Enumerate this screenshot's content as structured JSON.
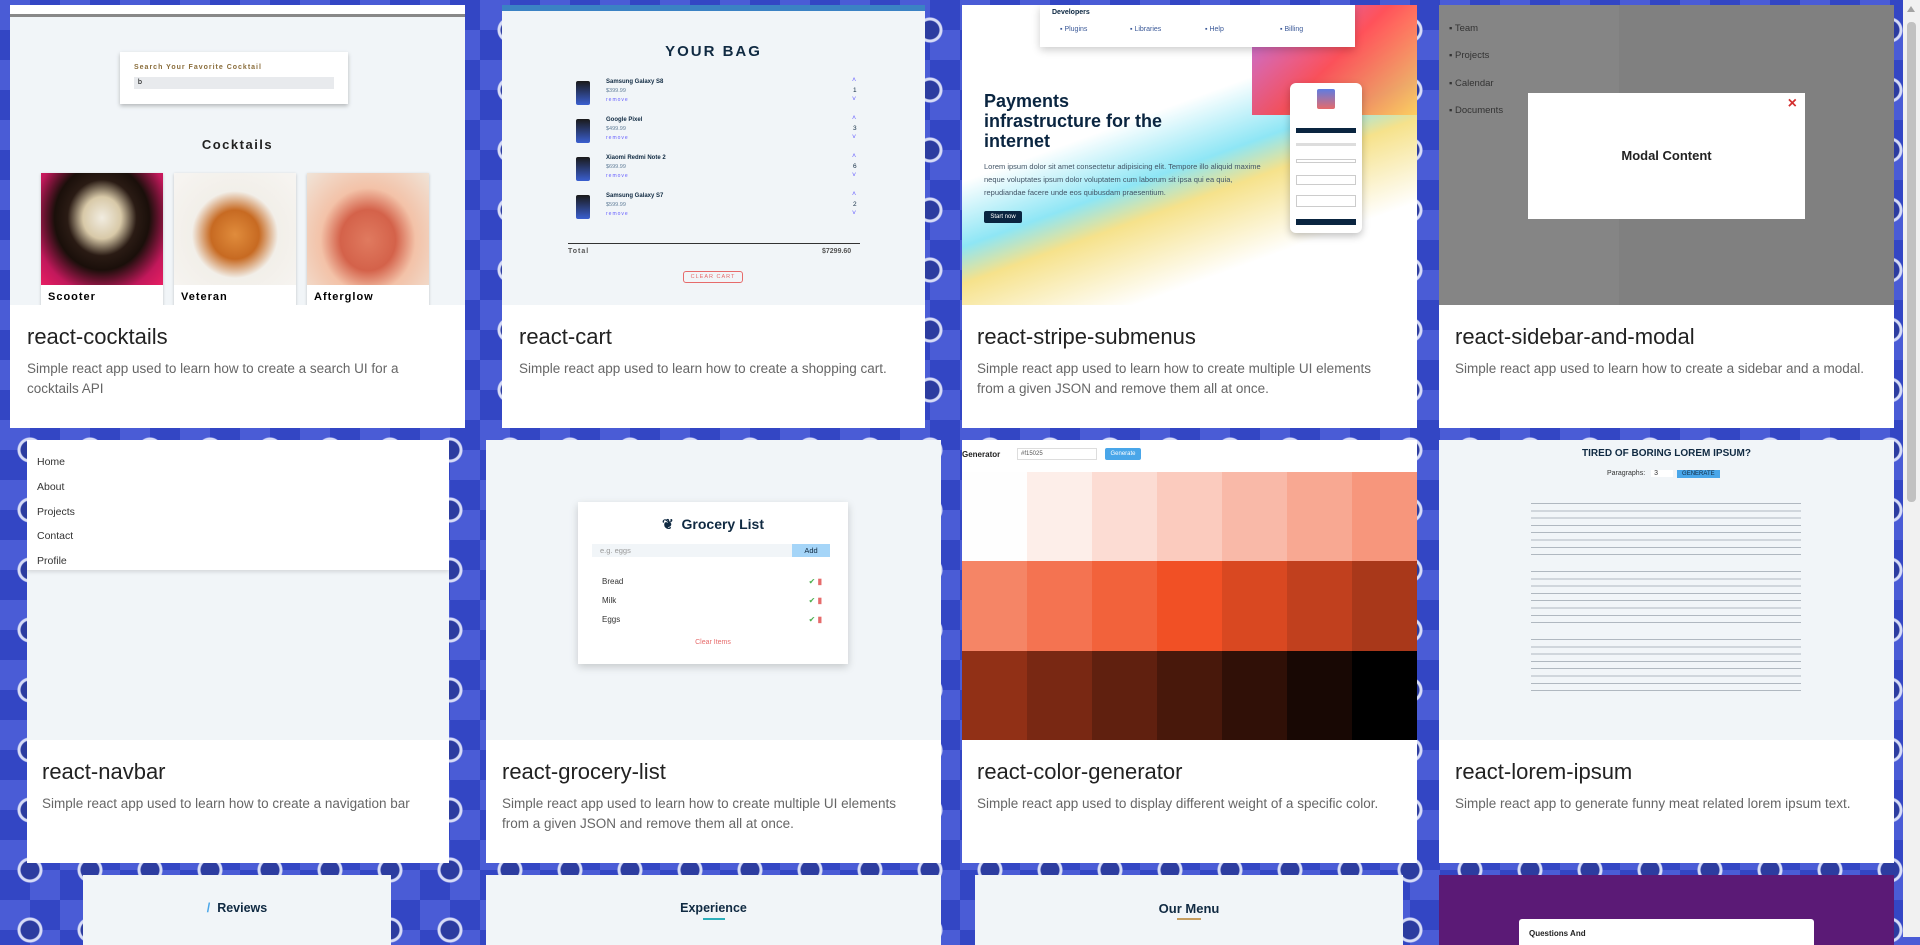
{
  "cards": [
    {
      "title": "react-cocktails",
      "desc": "Simple react app used to learn how to create a search UI for a cocktails API",
      "thumb": {
        "search_label": "Search Your Favorite Cocktail",
        "search_value": "b",
        "heading": "Cocktails",
        "items": [
          "Scooter",
          "Veteran",
          "Afterglow"
        ]
      }
    },
    {
      "title": "react-cart",
      "desc": "Simple react app used to learn how to create a shopping cart.",
      "thumb": {
        "heading": "YOUR BAG",
        "items": [
          {
            "name": "Samsung Galaxy S8",
            "price": "$399.99",
            "qty": "1"
          },
          {
            "name": "Google Pixel",
            "price": "$499.99",
            "qty": "3"
          },
          {
            "name": "Xiaomi Redmi Note 2",
            "price": "$699.99",
            "qty": "6"
          },
          {
            "name": "Samsung Galaxy S7",
            "price": "$599.99",
            "qty": "2"
          }
        ],
        "remove": "remove",
        "total_label": "Total",
        "total": "$7299.60",
        "clear": "CLEAR CART"
      }
    },
    {
      "title": "react-stripe-submenus",
      "desc": "Simple react app used to learn how to create multiple UI elements from a given JSON and remove them all at once.",
      "thumb": {
        "menu_heading": "Developers",
        "menu_items": [
          "Plugins",
          "Libraries",
          "Help",
          "Billing"
        ],
        "headline": "Payments infrastructure for the internet",
        "body": "Lorem ipsum dolor sit amet consectetur adipisicing elit. Tempore illo aliquid maxime neque voluptates ipsum dolor voluptatem cum laborum sit ipsa qui ea quia, repudiandae facere unde eos quibusdam praesentium.",
        "cta": "Start now"
      }
    },
    {
      "title": "react-sidebar-and-modal",
      "desc": "Simple react app used to learn how to create a sidebar and a modal.",
      "thumb": {
        "sidebar": [
          "Team",
          "Projects",
          "Calendar",
          "Documents"
        ],
        "modal": "Modal Content"
      }
    },
    {
      "title": "react-navbar",
      "desc": "Simple react app used to learn how to create a navigation bar",
      "thumb": {
        "links": [
          "Home",
          "About",
          "Projects",
          "Contact",
          "Profile"
        ]
      }
    },
    {
      "title": "react-grocery-list",
      "desc": "Simple react app used to learn how to create multiple UI elements from a given JSON and remove them all at once.",
      "thumb": {
        "heading": "Grocery List",
        "placeholder": "e.g. eggs",
        "add": "Add",
        "items": [
          "Bread",
          "Milk",
          "Eggs"
        ],
        "clear": "Clear Items"
      }
    },
    {
      "title": "react-color-generator",
      "desc": "Simple react app used to display different weight of a specific color.",
      "thumb": {
        "label": "Generator",
        "value": "#f15025",
        "button": "Generate"
      }
    },
    {
      "title": "react-lorem-ipsum",
      "desc": "Simple react app to generate funny meat related lorem ipsum text.",
      "thumb": {
        "heading": "TIRED OF BORING LOREM IPSUM?",
        "para_label": "Paragraphs:",
        "para_value": "3",
        "button": "GENERATE"
      }
    }
  ],
  "bottom": [
    "Reviews",
    "Experience",
    "Our Menu",
    "Questions And"
  ],
  "colors": {
    "accent": "#49a6e9",
    "danger": "#e66b6b",
    "stripe_btn": "#0a2540",
    "cart_accent": "#645cff",
    "menu_accent": "#c59d5f"
  }
}
